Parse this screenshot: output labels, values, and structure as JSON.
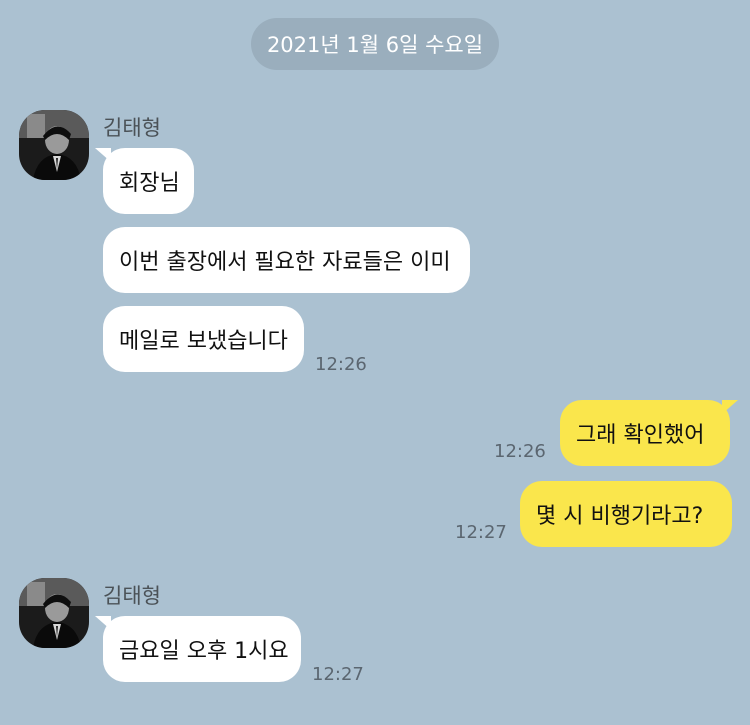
{
  "date_divider": "2021년 1월 6일 수요일",
  "colors": {
    "background": "#abc1d1",
    "date_pill": "#9aaebd",
    "incoming_bubble": "#ffffff",
    "outgoing_bubble": "#fae64c"
  },
  "groups": [
    {
      "sender": "김태형",
      "avatar": "profile-photo",
      "messages": [
        "회장님",
        "이번 출장에서 필요한 자료들은 이미",
        "메일로 보냈습니다"
      ],
      "time": "12:26"
    },
    {
      "messages": [
        "그래 확인했어",
        "몇 시 비행기라고?"
      ],
      "times": [
        "12:26",
        "12:27"
      ]
    },
    {
      "sender": "김태형",
      "avatar": "profile-photo",
      "messages": [
        "금요일 오후 1시요"
      ],
      "time": "12:27"
    }
  ]
}
